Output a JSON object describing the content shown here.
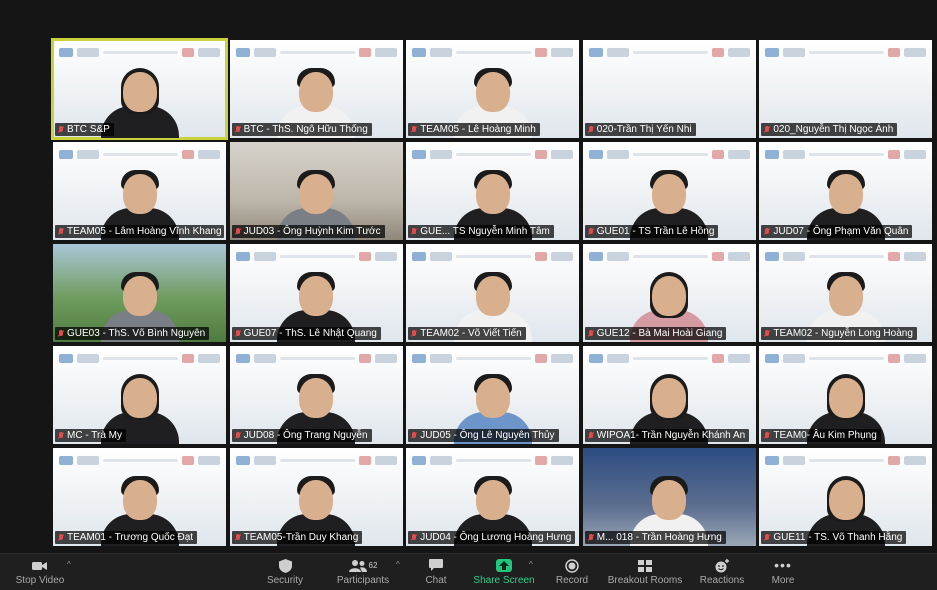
{
  "participants": [
    {
      "name": "BTC S&P",
      "active": true,
      "bg": "bg-banner",
      "shirt": "shirt-black",
      "hair": "long"
    },
    {
      "name": "BTC - ThS. Ngô Hữu Thống",
      "bg": "bg-banner",
      "shirt": "shirt-white"
    },
    {
      "name": "TEAM05 - Lê Hoàng Minh",
      "bg": "bg-banner",
      "shirt": "shirt-white"
    },
    {
      "name": "020-Trần Thị Yến Nhi",
      "bg": "bg-banner",
      "shirt": "shirt-white",
      "nobody": true
    },
    {
      "name": "020_Nguyễn Thị Ngọc Ánh",
      "bg": "bg-banner",
      "shirt": "shirt-white",
      "nobody": true
    },
    {
      "name": "TEAM05 - Lâm Hoàng Vĩnh Khang",
      "bg": "bg-banner",
      "shirt": "shirt-black"
    },
    {
      "name": "JUD03 - Ông Huỳnh Kim Tước",
      "bg": "bg-room",
      "shirt": "shirt-gray"
    },
    {
      "name": "GUE... TS Nguyễn Minh Tâm",
      "bg": "bg-banner",
      "shirt": "shirt-black"
    },
    {
      "name": "GUE01 - TS Trần Lê Hồng",
      "bg": "bg-banner",
      "shirt": "shirt-black"
    },
    {
      "name": "JUD07 - Ông Phạm Văn Quân",
      "bg": "bg-banner",
      "shirt": "shirt-black"
    },
    {
      "name": "GUE03 - ThS. Võ Bình Nguyên",
      "bg": "bg-garden",
      "shirt": "shirt-gray"
    },
    {
      "name": "GUE07 - ThS. Lê Nhật Quang",
      "bg": "bg-banner",
      "shirt": "shirt-black"
    },
    {
      "name": "TEAM02 - Võ Viết Tiến",
      "bg": "bg-banner",
      "shirt": "shirt-white"
    },
    {
      "name": "GUE12 - Bà Mai Hoài Giang",
      "bg": "bg-banner",
      "shirt": "shirt-pink",
      "hair": "long"
    },
    {
      "name": "TEAM02 - Nguyễn Long Hoàng",
      "bg": "bg-banner",
      "shirt": "shirt-white"
    },
    {
      "name": "MC - Trà My",
      "bg": "bg-banner",
      "shirt": "shirt-black",
      "hair": "long"
    },
    {
      "name": "JUD08 - Ông Trang Nguyễn",
      "bg": "bg-banner",
      "shirt": "shirt-black"
    },
    {
      "name": "JUD05 - Ông Lê Nguyên Thủy",
      "bg": "bg-banner",
      "shirt": "shirt-blue"
    },
    {
      "name": "WIPOA1- Trần Nguyễn Khánh An",
      "bg": "bg-banner",
      "shirt": "shirt-black",
      "hair": "long"
    },
    {
      "name": "TEAM0- Âu Kim Phụng",
      "bg": "bg-banner",
      "shirt": "shirt-black",
      "hair": "long"
    },
    {
      "name": "TEAM01 - Trương Quốc Đạt",
      "bg": "bg-banner",
      "shirt": "shirt-black"
    },
    {
      "name": "TEAM05-Trần Duy Khang",
      "bg": "bg-banner",
      "shirt": "shirt-black"
    },
    {
      "name": "JUD04 - Ông Lương Hoàng Hưng",
      "bg": "bg-banner",
      "shirt": "shirt-black"
    },
    {
      "name": "M... 018 - Trần Hoàng Hưng",
      "bg": "bg-blue",
      "shirt": "shirt-white"
    },
    {
      "name": "GUE11 - TS. Võ Thanh Hằng",
      "bg": "bg-banner",
      "shirt": "shirt-black",
      "hair": "long"
    }
  ],
  "toolbar": {
    "stop_video": "Stop Video",
    "security": "Security",
    "participants": "Participants",
    "participants_count": "62",
    "chat": "Chat",
    "share_screen": "Share Screen",
    "record": "Record",
    "breakout": "Breakout Rooms",
    "reactions": "Reactions",
    "more": "More"
  },
  "colors": {
    "active_outline": "#c9d23a",
    "share_green": "#22c77d",
    "muted_red": "#e24b4b"
  },
  "icons": [
    "video-camera-icon",
    "shield-icon",
    "participants-icon",
    "chat-bubble-icon",
    "share-screen-icon",
    "record-icon",
    "breakout-rooms-icon",
    "reactions-icon",
    "more-icon",
    "muted-mic-icon"
  ]
}
